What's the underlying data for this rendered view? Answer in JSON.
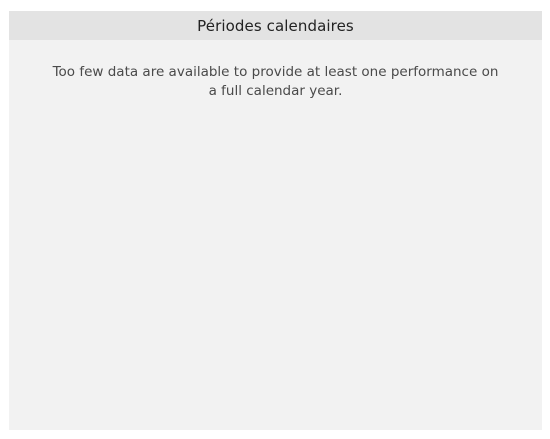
{
  "panel": {
    "title": "Périodes calendaires",
    "message": "Too few data are available to provide at least one performance on a full calendar year."
  }
}
